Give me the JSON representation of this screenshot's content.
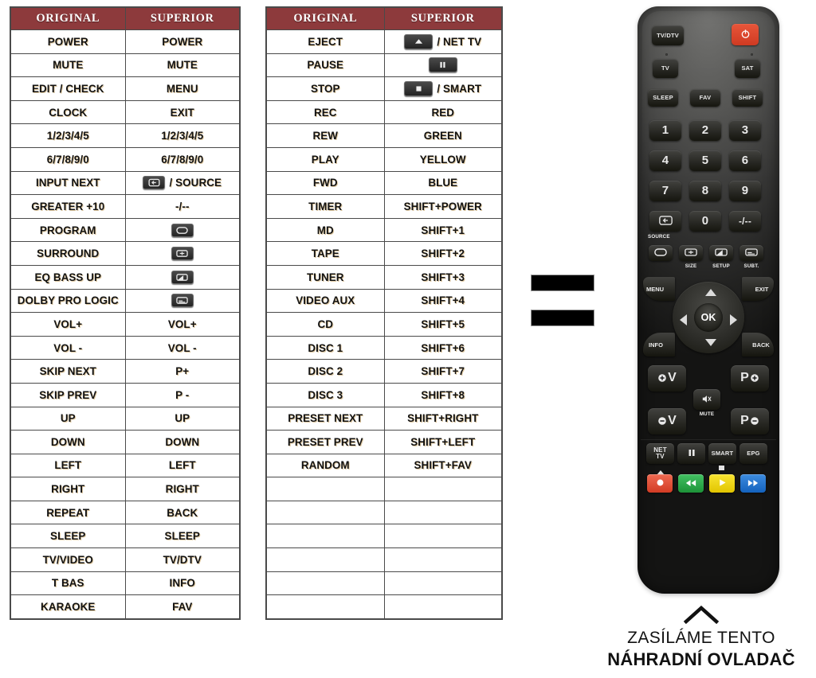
{
  "tables": [
    {
      "id": "table-left",
      "headers": [
        "ORIGINAL",
        "SUPERIOR"
      ],
      "rows": [
        {
          "original": "POWER",
          "superior": "POWER"
        },
        {
          "original": "MUTE",
          "superior": "MUTE"
        },
        {
          "original": "EDIT / CHECK",
          "superior": "MENU"
        },
        {
          "original": "CLOCK",
          "superior": "EXIT"
        },
        {
          "original": "1/2/3/4/5",
          "superior": "1/2/3/4/5"
        },
        {
          "original": "6/7/8/9/0",
          "superior": "6/7/8/9/0"
        },
        {
          "original": "INPUT NEXT",
          "superior": "/ SOURCE",
          "icon": "source-chip"
        },
        {
          "original": "GREATER +10",
          "superior": "-/--"
        },
        {
          "original": "PROGRAM",
          "superior": "",
          "icon": "screen-chip"
        },
        {
          "original": "SURROUND",
          "superior": "",
          "icon": "size-chip"
        },
        {
          "original": "EQ BASS UP",
          "superior": "",
          "icon": "setup-chip"
        },
        {
          "original": "DOLBY PRO LOGIC",
          "superior": "",
          "icon": "subtitle-chip",
          "small": true
        },
        {
          "original": "VOL+",
          "superior": "VOL+"
        },
        {
          "original": "VOL -",
          "superior": "VOL -"
        },
        {
          "original": "SKIP NEXT",
          "superior": "P+"
        },
        {
          "original": "SKIP PREV",
          "superior": "P -"
        },
        {
          "original": "UP",
          "superior": "UP"
        },
        {
          "original": "DOWN",
          "superior": "DOWN"
        },
        {
          "original": "LEFT",
          "superior": "LEFT"
        },
        {
          "original": "RIGHT",
          "superior": "RIGHT"
        },
        {
          "original": "REPEAT",
          "superior": "BACK"
        },
        {
          "original": "SLEEP",
          "superior": "SLEEP"
        },
        {
          "original": "TV/VIDEO",
          "superior": "TV/DTV"
        },
        {
          "original": "T BAS",
          "superior": "INFO"
        },
        {
          "original": "KARAOKE",
          "superior": "FAV"
        }
      ]
    },
    {
      "id": "table-right",
      "headers": [
        "ORIGINAL",
        "SUPERIOR"
      ],
      "rows": [
        {
          "original": "EJECT",
          "superior": "/ NET TV",
          "icon": "eject-chip"
        },
        {
          "original": "PAUSE",
          "superior": "",
          "icon": "pause-chip"
        },
        {
          "original": "STOP",
          "superior": "/ SMART",
          "icon": "stop-chip"
        },
        {
          "original": "REC",
          "superior": "RED"
        },
        {
          "original": "REW",
          "superior": "GREEN"
        },
        {
          "original": "PLAY",
          "superior": "YELLOW"
        },
        {
          "original": "FWD",
          "superior": "BLUE"
        },
        {
          "original": "TIMER",
          "superior": "SHIFT+POWER"
        },
        {
          "original": "MD",
          "superior": "SHIFT+1"
        },
        {
          "original": "TAPE",
          "superior": "SHIFT+2"
        },
        {
          "original": "TUNER",
          "superior": "SHIFT+3"
        },
        {
          "original": "VIDEO AUX",
          "superior": "SHIFT+4"
        },
        {
          "original": "CD",
          "superior": "SHIFT+5"
        },
        {
          "original": "DISC 1",
          "superior": "SHIFT+6"
        },
        {
          "original": "DISC 2",
          "superior": "SHIFT+7"
        },
        {
          "original": "DISC 3",
          "superior": "SHIFT+8"
        },
        {
          "original": "PRESET NEXT",
          "superior": "SHIFT+RIGHT"
        },
        {
          "original": "PRESET PREV",
          "superior": "SHIFT+LEFT"
        },
        {
          "original": "RANDOM",
          "superior": "SHIFT+FAV"
        },
        {
          "original": "",
          "superior": ""
        },
        {
          "original": "",
          "superior": ""
        },
        {
          "original": "",
          "superior": ""
        },
        {
          "original": "",
          "superior": ""
        },
        {
          "original": "",
          "superior": ""
        },
        {
          "original": "",
          "superior": ""
        }
      ]
    }
  ],
  "redaction_bars": [
    {
      "name": "redaction-bar-top"
    },
    {
      "name": "redaction-bar-bottom"
    }
  ],
  "remote": {
    "buttons": {
      "tvdtv": "TV/DTV",
      "power": "power-icon",
      "tv": "TV",
      "sat": "SAT",
      "sleep": "SLEEP",
      "fav": "FAV",
      "shift": "SHIFT",
      "n1": "1",
      "n2": "2",
      "n3": "3",
      "n4": "4",
      "n5": "5",
      "n6": "6",
      "n7": "7",
      "n8": "8",
      "n9": "9",
      "n0": "0",
      "source": "SOURCE",
      "dash": "-/--",
      "size": "SIZE",
      "setup": "SETUP",
      "subt": "SUBT.",
      "menu": "MENU",
      "exit": "EXIT",
      "ok": "OK",
      "info": "INFO",
      "back": "BACK",
      "volup": "V",
      "voldown": "V",
      "mute": "MUTE",
      "progup": "P",
      "progdown": "P",
      "nettv": "NET\nTV",
      "pause": "pause-icon",
      "smart": "SMART",
      "epg": "EPG"
    },
    "color_buttons": [
      {
        "name": "record-button",
        "color": "#e24b3a",
        "glyph": "record-icon"
      },
      {
        "name": "rewind-button",
        "color": "#27a844",
        "glyph": "rewind-icon"
      },
      {
        "name": "play-button",
        "color": "#f2d80c",
        "glyph": "play-icon"
      },
      {
        "name": "fast-forward-button",
        "color": "#2176d2",
        "glyph": "fast-forward-icon"
      }
    ]
  },
  "caption": {
    "line1": "ZASÍLÁME TENTO",
    "line2": "NÁHRADNÍ OVLADAČ"
  },
  "colors": {
    "table_header_bg": "#8d3a3c",
    "table_border": "#4a4a4a",
    "page_bg": "#ffffff",
    "remote_body": "#3a3a39"
  }
}
